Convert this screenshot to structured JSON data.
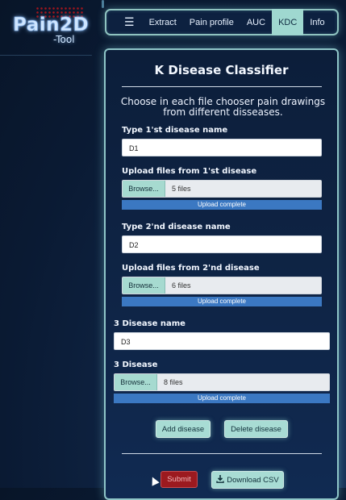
{
  "brand": {
    "logo_text": "Pain2D",
    "sub_text": "-Tool"
  },
  "nav": {
    "menu_icon": "☰",
    "items": [
      {
        "label": "Extract"
      },
      {
        "label": "Pain profile"
      },
      {
        "label": "AUC"
      },
      {
        "label": "KDC",
        "active": true
      },
      {
        "label": "Info"
      }
    ]
  },
  "panel": {
    "title": "K Disease Classifier",
    "instructions": "Choose in each file chooser pain drawings from different disseases.",
    "diseases": [
      {
        "name_label": "Type 1'st disease name",
        "name_value": "D1",
        "upload_label": "Upload files from 1'st disease",
        "browse_label": "Browse...",
        "file_count": "5 files",
        "progress_text": "Upload complete",
        "progress": 1.0
      },
      {
        "name_label": "Type 2'nd disease name",
        "name_value": "D2",
        "upload_label": "Upload files from 2'nd disease",
        "browse_label": "Browse...",
        "file_count": "6 files",
        "progress_text": "Upload complete",
        "progress": 1.0
      },
      {
        "name_label": "3 Disease name",
        "name_value": "D3",
        "upload_label": "3 Disease",
        "browse_label": "Browse...",
        "file_count": "8 files",
        "progress_text": "Upload complete",
        "progress": 1.0
      }
    ],
    "add_button": "Add disease",
    "delete_button": "Delete disease",
    "submit_button": "Submit",
    "download_button": "Download CSV"
  },
  "colors": {
    "accent_teal": "#a8dcd4",
    "progress_blue": "#3b78c2",
    "submit_red": "#9c1a1f",
    "panel_border": "#8fc6c8"
  }
}
